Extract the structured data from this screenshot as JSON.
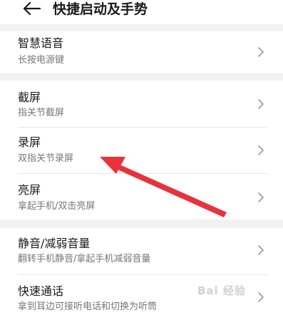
{
  "header": {
    "title": "快捷启动及手势",
    "back_icon": "arrow-left-icon"
  },
  "sections": [
    {
      "items": [
        {
          "label": "智慧语音",
          "sub": "长按电源键"
        }
      ]
    },
    {
      "items": [
        {
          "label": "截屏",
          "sub": "指关节截屏"
        },
        {
          "label": "录屏",
          "sub": "双指关节录屏"
        },
        {
          "label": "亮屏",
          "sub": "拿起手机/双击亮屏"
        }
      ]
    },
    {
      "items": [
        {
          "label": "静音/减弱音量",
          "sub": "翻转手机静音/拿起手机减弱音量"
        },
        {
          "label": "快速通话",
          "sub": "拿到耳边可接听电话和切换为听筒"
        }
      ]
    }
  ],
  "chevron_icon": "chevron-right-icon",
  "annotation": {
    "color": "#e8323c",
    "points_to": "录屏"
  },
  "watermark": {
    "text": "Bai 经验"
  },
  "colors": {
    "background": "#ffffff",
    "separator": "#f2f2f2",
    "subtext": "#777777"
  }
}
